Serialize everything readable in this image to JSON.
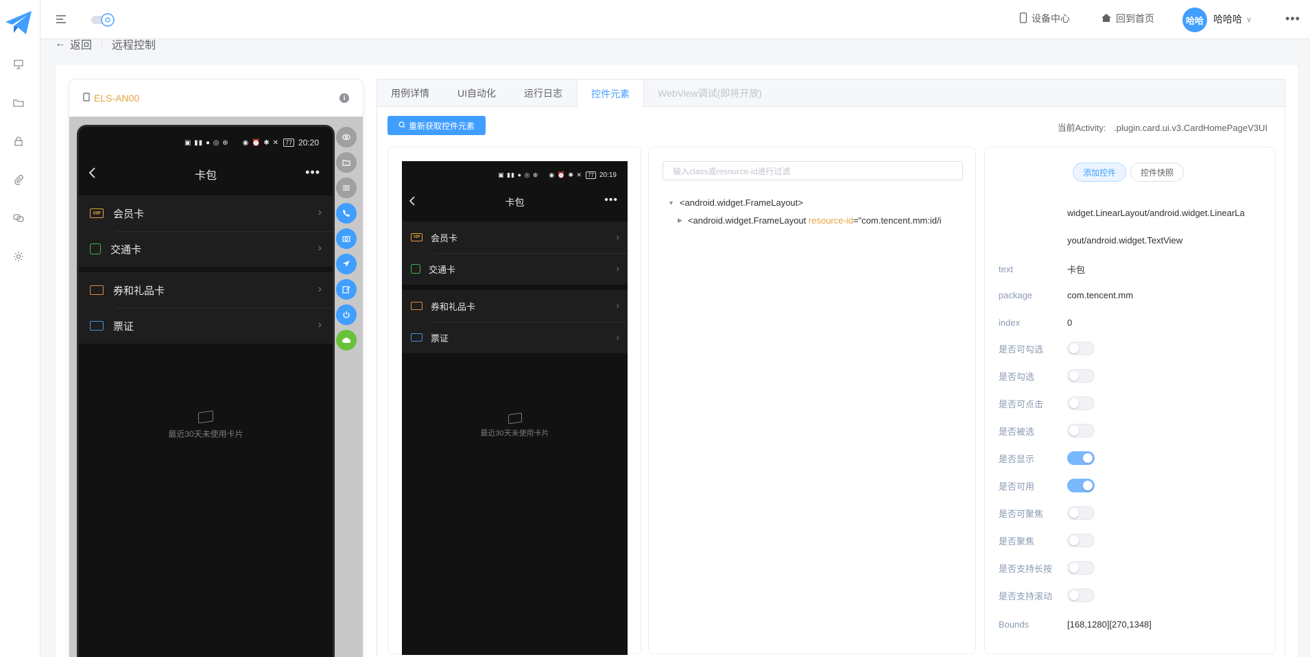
{
  "topbar": {
    "device_center": "设备中心",
    "home": "回到首页",
    "avatar_text": "哈哈",
    "user_name": "哈哈哈"
  },
  "breadcrumb": {
    "back": "返回",
    "title": "远程控制"
  },
  "device": {
    "name": "ELS-AN00",
    "status_time": "20:20",
    "battery": "77",
    "header_title": "卡包",
    "items": [
      {
        "label": "会员卡",
        "icon": "VIP",
        "color": "#e6a23c"
      },
      {
        "label": "交通卡",
        "icon": "bus",
        "color": "#3fb950"
      },
      {
        "label": "券和礼品卡",
        "icon": "ticket",
        "color": "#e68a3c"
      },
      {
        "label": "票证",
        "icon": "id",
        "color": "#4a90e2"
      }
    ],
    "empty_text": "最近30天未使用卡片"
  },
  "tabs": [
    {
      "label": "用例详情"
    },
    {
      "label": "UI自动化"
    },
    {
      "label": "运行日志"
    },
    {
      "label": "控件元素"
    },
    {
      "label": "WebView调试(即将开放)"
    }
  ],
  "elements": {
    "refresh_button": "重新获取控件元素",
    "activity_label": "当前Activity:",
    "activity_value": ".plugin.card.ui.v3.CardHomePageV3UI",
    "screenshot_time": "20:19",
    "filter_placeholder": "输入class或resource-id进行过滤",
    "tree": {
      "root": "<android.widget.FrameLayout>",
      "child_prefix": "<android.widget.FrameLayout",
      "child_attr": "resource-id",
      "child_value": "=\"com.tencent.mm:id/i"
    }
  },
  "props": {
    "add_button": "添加控件",
    "snapshot_button": "控件快照",
    "class_line1": "widget.LinearLayout/android.widget.LinearLa",
    "class_line2": "yout/android.widget.TextView",
    "text_key": "text",
    "text_val": "卡包",
    "package_key": "package",
    "package_val": "com.tencent.mm",
    "index_key": "index",
    "index_val": "0",
    "toggles": [
      {
        "label": "是否可勾选",
        "on": false
      },
      {
        "label": "是否勾选",
        "on": false
      },
      {
        "label": "是否可点击",
        "on": false
      },
      {
        "label": "是否被选",
        "on": false
      },
      {
        "label": "是否显示",
        "on": true
      },
      {
        "label": "是否可用",
        "on": true
      },
      {
        "label": "是否可聚焦",
        "on": false
      },
      {
        "label": "是否聚焦",
        "on": false
      },
      {
        "label": "是否支持长按",
        "on": false
      },
      {
        "label": "是否支持滚动",
        "on": false
      }
    ],
    "bounds_key": "Bounds",
    "bounds_val": "[168,1280][270,1348]"
  }
}
